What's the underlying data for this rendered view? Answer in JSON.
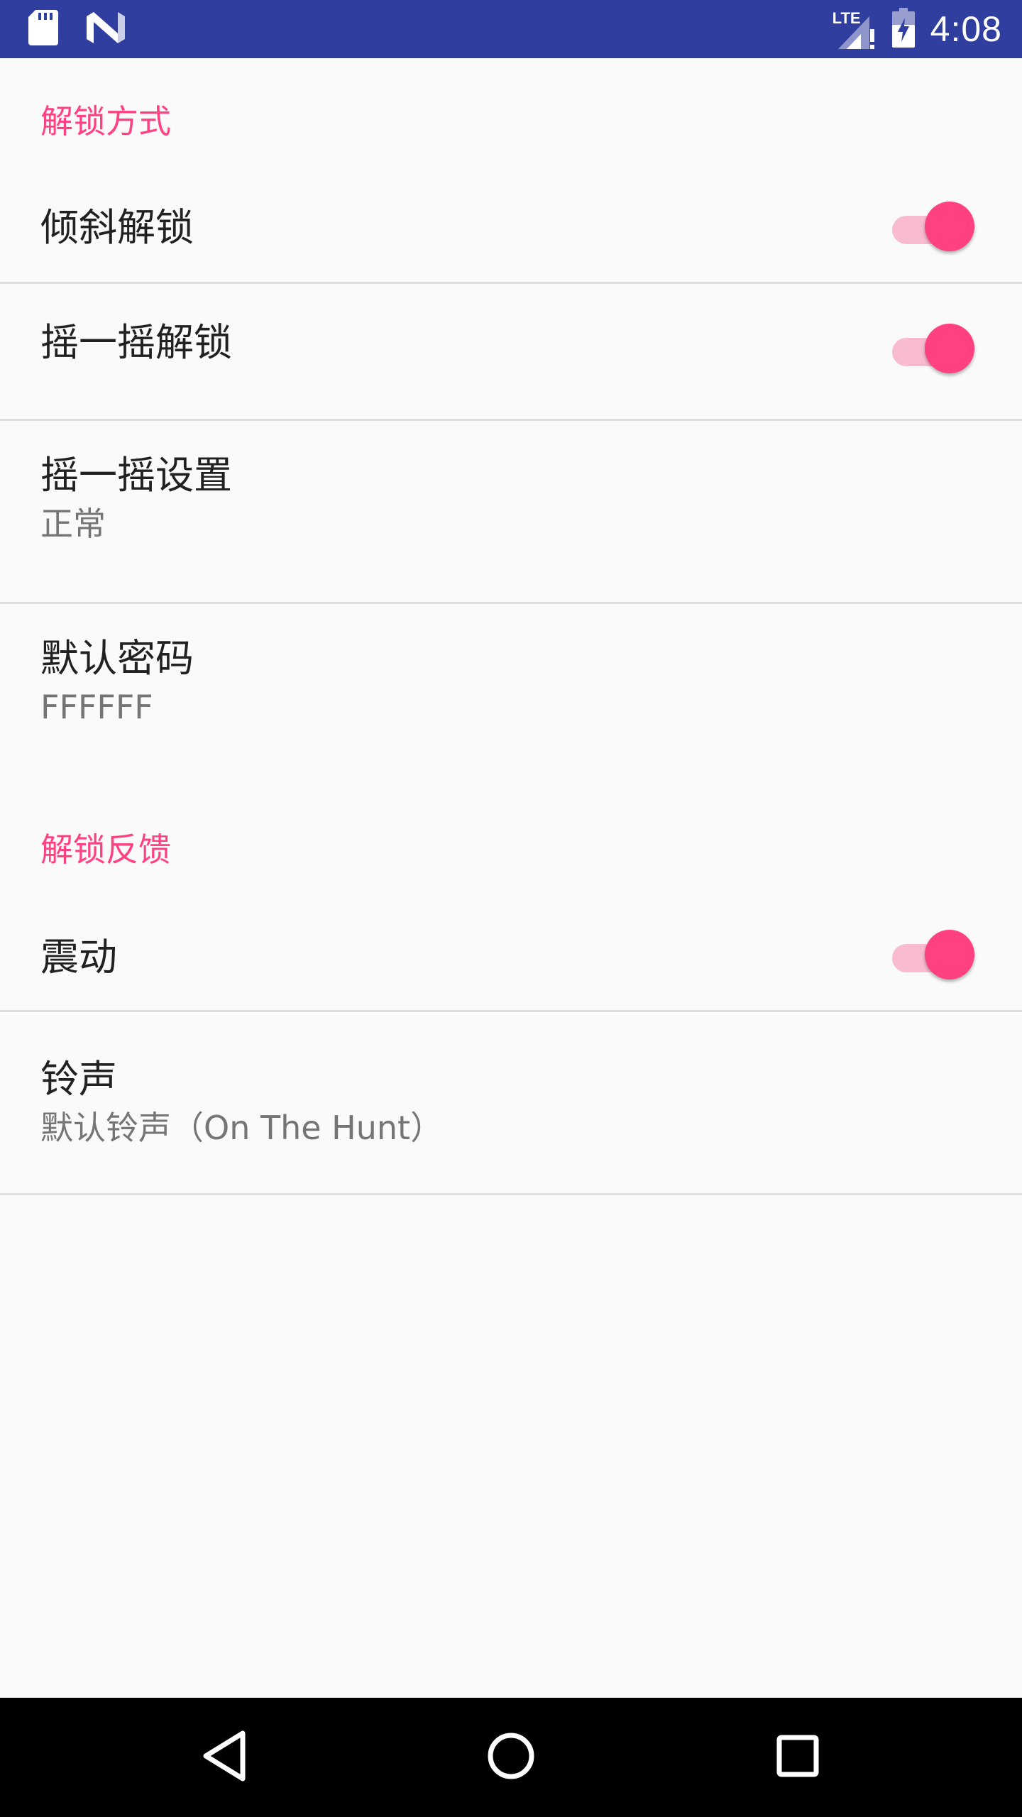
{
  "status_bar": {
    "time": "4:08",
    "network_label": "LTE",
    "icons": [
      "sd-card-icon",
      "nougat-n-icon",
      "lte-signal-icon",
      "battery-charging-icon"
    ],
    "color": "#303f9f"
  },
  "accent_color": "#ff4081",
  "categories": [
    {
      "title": "解锁方式"
    },
    {
      "title": "解锁反馈"
    }
  ],
  "prefs": {
    "tilt_unlock": {
      "title": "倾斜解锁",
      "enabled": true
    },
    "shake_unlock": {
      "title": "摇一摇解锁",
      "enabled": true
    },
    "shake_settings": {
      "title": "摇一摇设置",
      "summary": "正常"
    },
    "default_password": {
      "title": "默认密码",
      "summary": "FFFFFF"
    },
    "vibration": {
      "title": "震动",
      "enabled": true
    },
    "ringtone": {
      "title": "铃声",
      "summary": "默认铃声（On The Hunt）"
    }
  },
  "nav_bar": {
    "buttons": [
      "back-icon",
      "home-icon",
      "recents-icon"
    ]
  }
}
